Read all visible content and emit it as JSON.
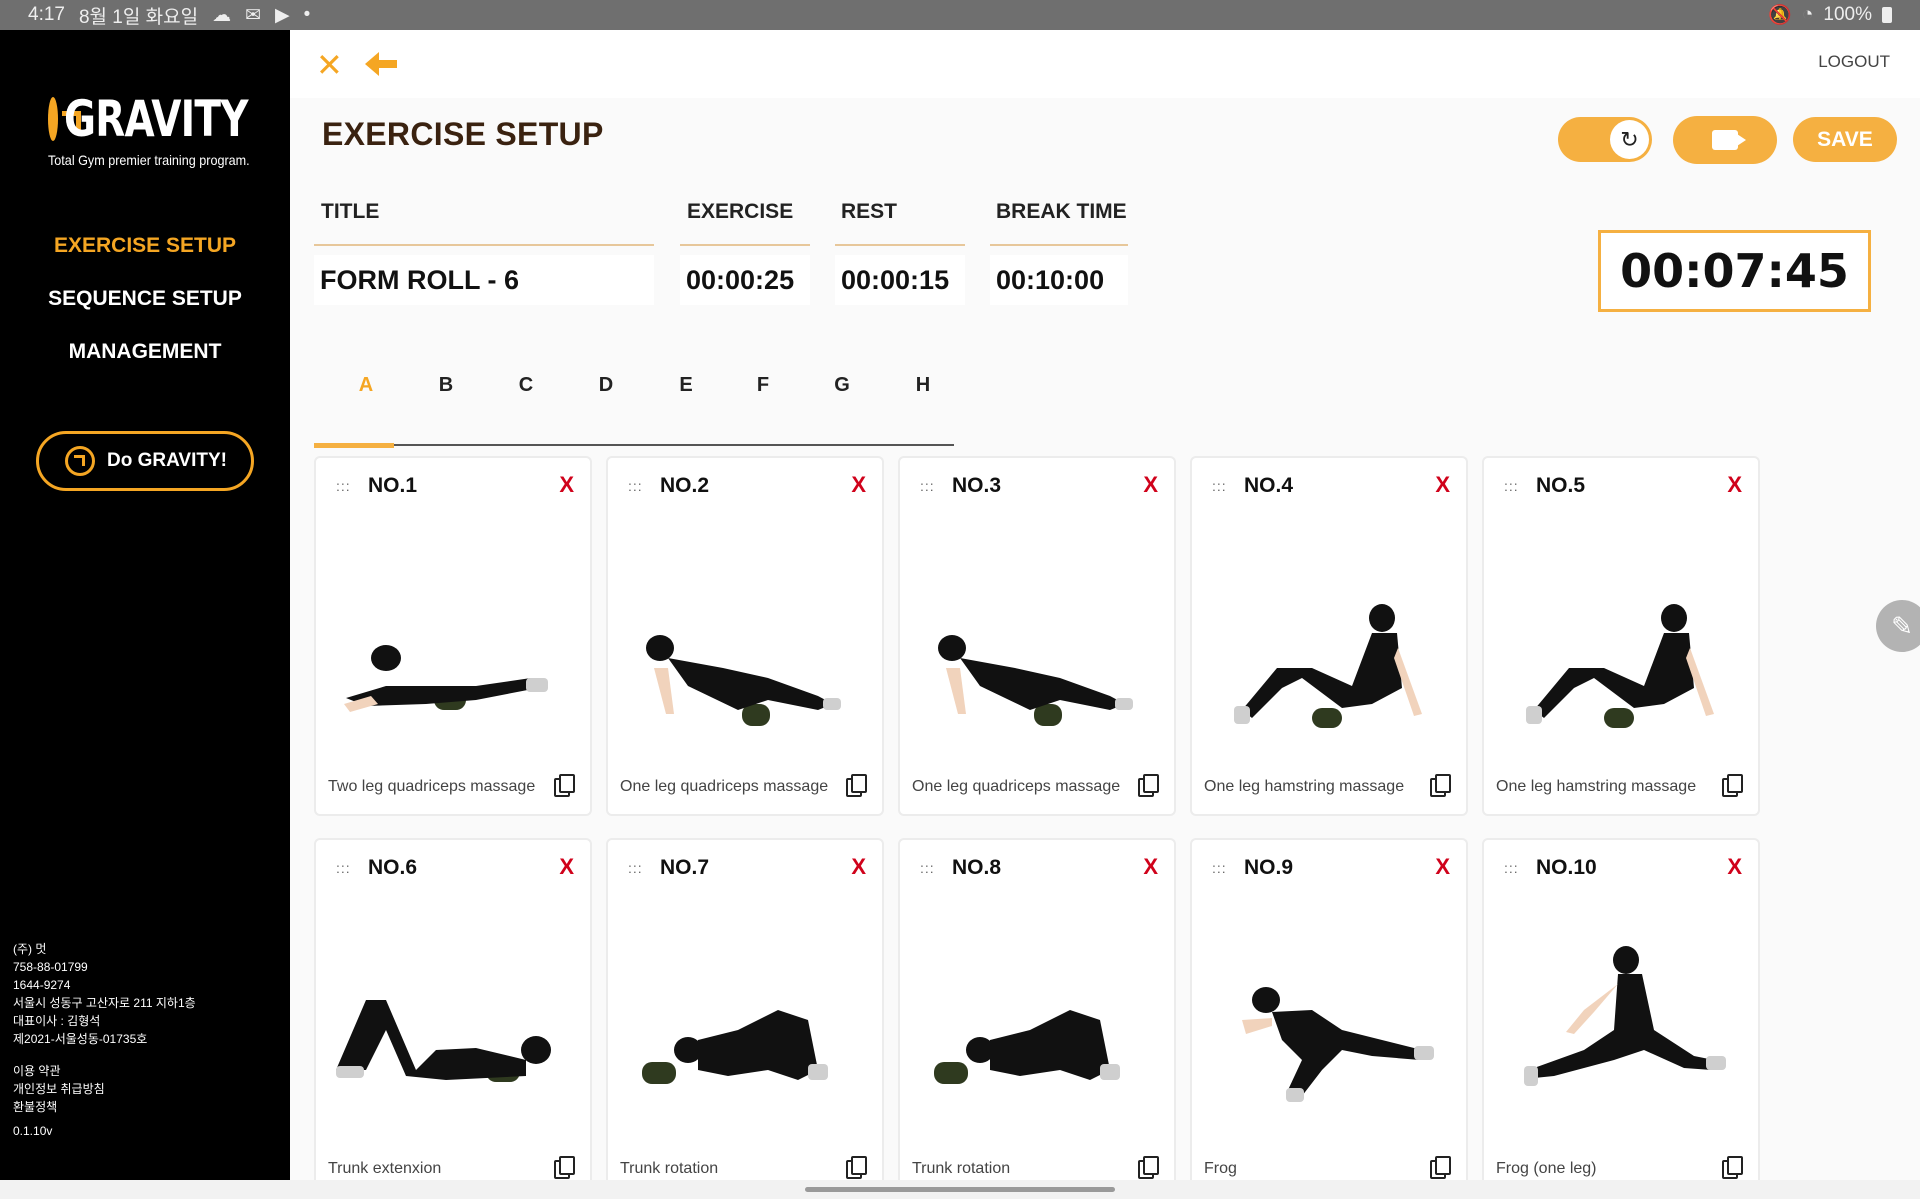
{
  "status_bar": {
    "time": "4:17",
    "date": "8월 1일 화요일",
    "battery": "100%"
  },
  "sidebar": {
    "logo_text": "GRAVITY",
    "tagline": "Total Gym premier training program.",
    "nav": [
      {
        "label": "EXERCISE SETUP",
        "active": true
      },
      {
        "label": "SEQUENCE SETUP",
        "active": false
      },
      {
        "label": "MANAGEMENT",
        "active": false
      }
    ],
    "cta_label": "Do GRAVITY!",
    "company_lines": [
      "(주) 멋",
      "758-88-01799",
      "1644-9274",
      "서울시 성동구 고산자로 211 지하1층",
      "대표이사 : 김형석",
      "제2021-서울성동-01735호"
    ],
    "legal_links": [
      "이용 약관",
      "개인정보 취급방침",
      "환불정책"
    ],
    "version": "0.1.10v"
  },
  "topbar": {
    "logout_label": "LOGOUT"
  },
  "page": {
    "title": "EXERCISE SETUP",
    "save_label": "SAVE",
    "total_time": "00:07:45"
  },
  "fields": {
    "title_label": "TITLE",
    "title_value": "FORM ROLL - 6",
    "exercise_label": "EXERCISE",
    "exercise_value": "00:00:25",
    "rest_label": "REST",
    "rest_value": "00:00:15",
    "break_label": "BREAK TIME",
    "break_value": "00:10:00"
  },
  "tabs": [
    "A",
    "B",
    "C",
    "D",
    "E",
    "F",
    "G",
    "H"
  ],
  "active_tab": "A",
  "cards": [
    {
      "no": "NO.1",
      "name": "Two leg quadriceps massage"
    },
    {
      "no": "NO.2",
      "name": "One leg quadriceps massage"
    },
    {
      "no": "NO.3",
      "name": "One leg quadriceps massage"
    },
    {
      "no": "NO.4",
      "name": "One leg hamstring massage"
    },
    {
      "no": "NO.5",
      "name": "One leg hamstring massage"
    },
    {
      "no": "NO.6",
      "name": "Trunk extenxion"
    },
    {
      "no": "NO.7",
      "name": "Trunk rotation"
    },
    {
      "no": "NO.8",
      "name": "Trunk rotation"
    },
    {
      "no": "NO.9",
      "name": "Frog"
    },
    {
      "no": "NO.10",
      "name": "Frog (one leg)"
    }
  ],
  "card_delete_label": "X",
  "card_drag_label": ":::",
  "colors": {
    "accent": "#f5a623",
    "accent_soft": "#f5b041",
    "delete": "#d0021b",
    "title": "#3a2210",
    "sidebar_bg": "#000000"
  }
}
